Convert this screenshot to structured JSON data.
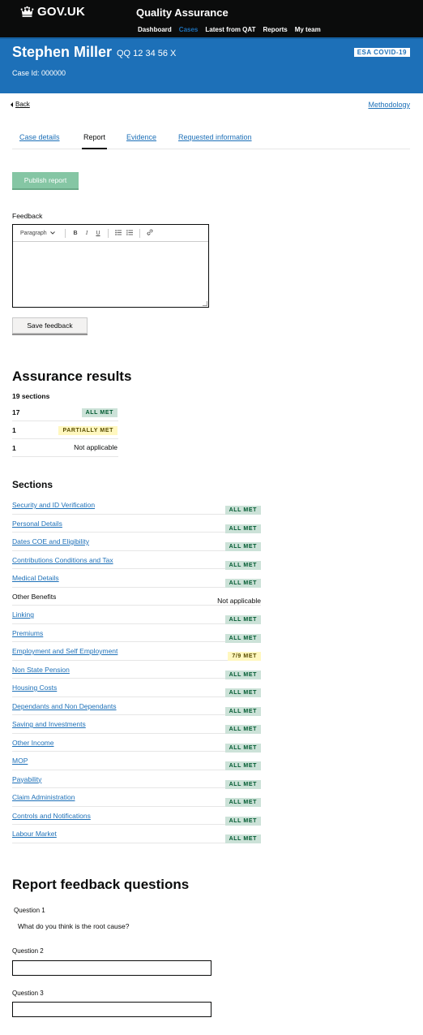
{
  "header": {
    "logo_text": "GOV.UK",
    "service_name": "Quality Assurance",
    "nav": [
      {
        "label": "Dashboard",
        "active": false
      },
      {
        "label": "Cases",
        "active": true
      },
      {
        "label": "Latest from QAT",
        "active": false
      },
      {
        "label": "Reports",
        "active": false
      },
      {
        "label": "My team",
        "active": false
      }
    ]
  },
  "case": {
    "name": "Stephen Miller",
    "nino": "QQ 12 34 56 X",
    "case_id": "Case Id: 000000",
    "benefit_tag": "ESA COVID-19"
  },
  "links": {
    "back": "Back",
    "methodology": "Methodology"
  },
  "tabs": [
    {
      "label": "Case details",
      "selected": false
    },
    {
      "label": "Report",
      "selected": true
    },
    {
      "label": "Evidence",
      "selected": false
    },
    {
      "label": "Requested information",
      "selected": false
    }
  ],
  "publish_label": "Publish report",
  "feedback": {
    "label": "Feedback",
    "toolbar": {
      "paragraph": "Paragraph",
      "bold": "B",
      "italic": "I",
      "underline": "U",
      "bullet_list": "bullet-list-icon",
      "numbered_list": "numbered-list-icon",
      "link": "link-icon"
    },
    "value": "",
    "save_label": "Save feedback"
  },
  "assurance": {
    "title": "Assurance results",
    "sections_count": "19 sections",
    "summary": [
      {
        "count": "17",
        "result": "ALL MET",
        "style": "green"
      },
      {
        "count": "1",
        "result": "PARTIALLY MET",
        "style": "yellow"
      },
      {
        "count": "1",
        "result": "Not applicable",
        "style": "plain"
      }
    ]
  },
  "sections": {
    "title": "Sections",
    "rows": [
      {
        "name": "Security and ID Verification",
        "status": "ALL MET",
        "style": "green",
        "link": true
      },
      {
        "name": "Personal Details",
        "status": "ALL MET",
        "style": "green",
        "link": true
      },
      {
        "name": "Dates COE and Eligibility",
        "status": "ALL MET",
        "style": "green",
        "link": true
      },
      {
        "name": "Contributions Conditions and Tax",
        "status": "ALL MET",
        "style": "green",
        "link": true
      },
      {
        "name": "Medical Details",
        "status": "ALL MET",
        "style": "green",
        "link": true
      },
      {
        "name": "Other Benefits",
        "status": "Not applicable",
        "style": "plain",
        "link": false
      },
      {
        "name": "Linking",
        "status": "ALL MET",
        "style": "green",
        "link": true
      },
      {
        "name": "Premiums",
        "status": "ALL MET",
        "style": "green",
        "link": true
      },
      {
        "name": "Employment and Self Employment",
        "status": "7/9 MET",
        "style": "yellow",
        "link": true
      },
      {
        "name": "Non State Pension",
        "status": "ALL MET",
        "style": "green",
        "link": true
      },
      {
        "name": "Housing Costs",
        "status": "ALL MET",
        "style": "green",
        "link": true
      },
      {
        "name": "Dependants and Non Dependants",
        "status": "ALL MET",
        "style": "green",
        "link": true
      },
      {
        "name": "Saving and Investments",
        "status": "ALL MET",
        "style": "green",
        "link": true
      },
      {
        "name": "Other Income",
        "status": "ALL MET",
        "style": "green",
        "link": true
      },
      {
        "name": "MOP",
        "status": "ALL MET",
        "style": "green",
        "link": true
      },
      {
        "name": "Payability",
        "status": "ALL MET",
        "style": "green",
        "link": true
      },
      {
        "name": "Claim Administration",
        "status": "ALL MET",
        "style": "green",
        "link": true
      },
      {
        "name": "Controls and Notifications",
        "status": "ALL MET",
        "style": "green",
        "link": true
      },
      {
        "name": "Labour Market",
        "status": "ALL MET",
        "style": "green",
        "link": true
      }
    ]
  },
  "questions": {
    "title": "Report feedback questions",
    "q1_label": "Question 1",
    "q1_text": "What do you think is the root cause?",
    "q2_label": "Question 2",
    "q2_value": "",
    "q3_label": "Question 3",
    "q3_value": ""
  },
  "colors": {
    "header_bg": "#0b0c0c",
    "banner_bg": "#1d70b8",
    "link": "#1d70b8",
    "green_tag_bg": "#cce2d8",
    "green_tag_text": "#005a30",
    "yellow_tag_bg": "#fff7bf",
    "yellow_tag_text": "#594d00",
    "publish_bg": "#85c6a4"
  }
}
